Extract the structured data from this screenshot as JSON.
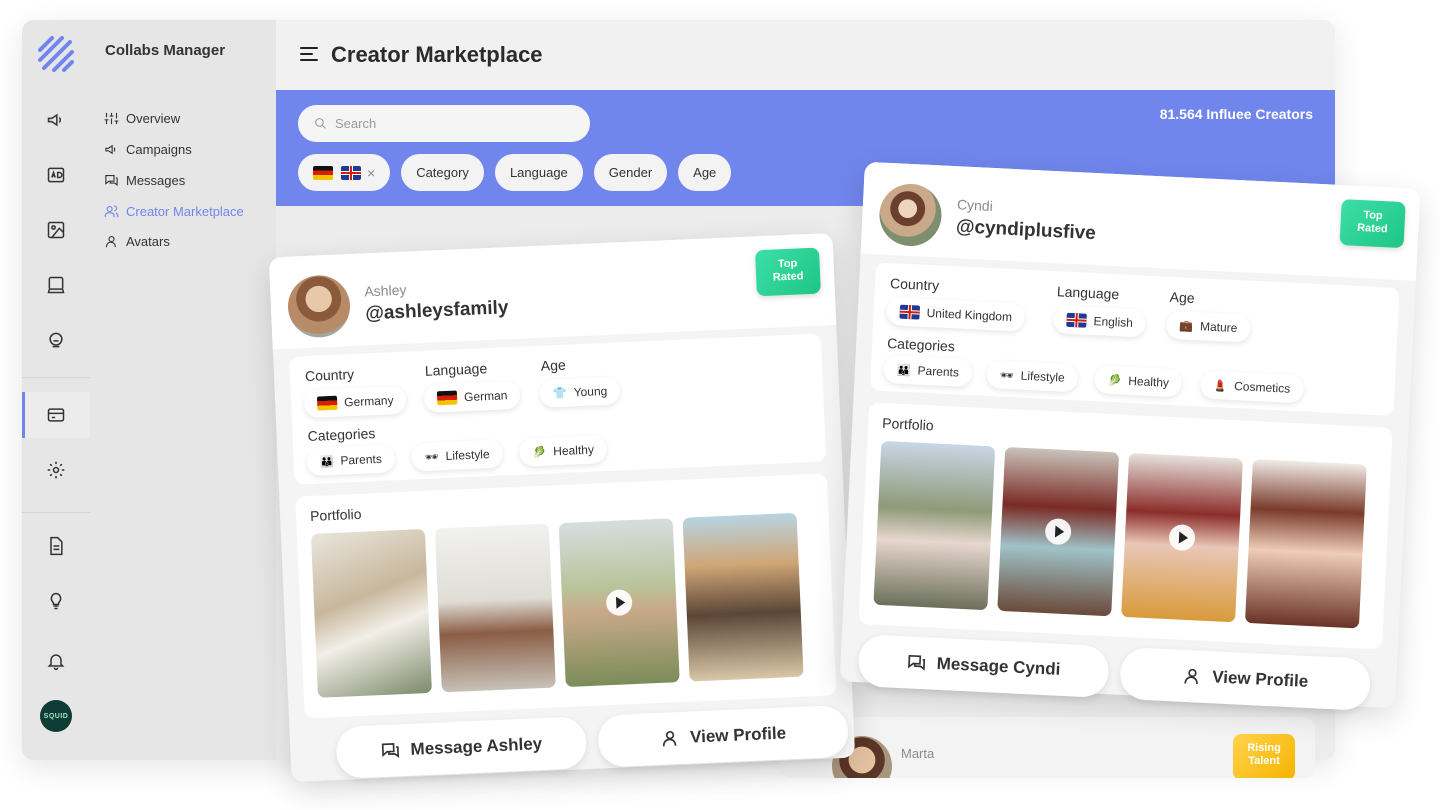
{
  "app": {
    "name": "Collabs Manager"
  },
  "nav": {
    "items": [
      {
        "label": "Overview",
        "icon": "sliders-icon"
      },
      {
        "label": "Campaigns",
        "icon": "megaphone-icon"
      },
      {
        "label": "Messages",
        "icon": "chat-icon"
      },
      {
        "label": "Creator Marketplace",
        "icon": "users-icon",
        "active": true
      },
      {
        "label": "Avatars",
        "icon": "user-icon"
      }
    ]
  },
  "header": {
    "title": "Creator Marketplace"
  },
  "search": {
    "placeholder": "Search"
  },
  "creators_count": "81.564 Influee Creators",
  "filters": {
    "category": "Category",
    "language": "Language",
    "gender": "Gender",
    "age": "Age",
    "remove": "×"
  },
  "avatar_badge": "SQUID",
  "cards": {
    "ashley": {
      "first_name": "Ashley",
      "handle": "@ashleysfamily",
      "badge_line1": "Top",
      "badge_line2": "Rated",
      "country_label": "Country",
      "country": "Germany",
      "language_label": "Language",
      "language": "German",
      "age_label": "Age",
      "age": "Young",
      "categories_label": "Categories",
      "categories": [
        "Parents",
        "Lifestyle",
        "Healthy"
      ],
      "portfolio_label": "Portfolio",
      "message_button": "Message Ashley",
      "profile_button": "View Profile"
    },
    "cyndi": {
      "first_name": "Cyndi",
      "handle": "@cyndiplusfive",
      "badge_line1": "Top",
      "badge_line2": "Rated",
      "country_label": "Country",
      "country": "United Kingdom",
      "language_label": "Language",
      "language": "English",
      "age_label": "Age",
      "age": "Mature",
      "categories_label": "Categories",
      "categories": [
        "Parents",
        "Lifestyle",
        "Healthy",
        "Cosmetics"
      ],
      "portfolio_label": "Portfolio",
      "message_button": "Message Cyndi",
      "profile_button": "View Profile"
    },
    "marta": {
      "first_name": "Marta",
      "badge_line1": "Rising",
      "badge_line2": "Talent"
    }
  },
  "colors": {
    "accent": "#7086ec",
    "top_rated": "#1fc486",
    "rising": "#f6b400",
    "app_bg": "#ececec"
  }
}
